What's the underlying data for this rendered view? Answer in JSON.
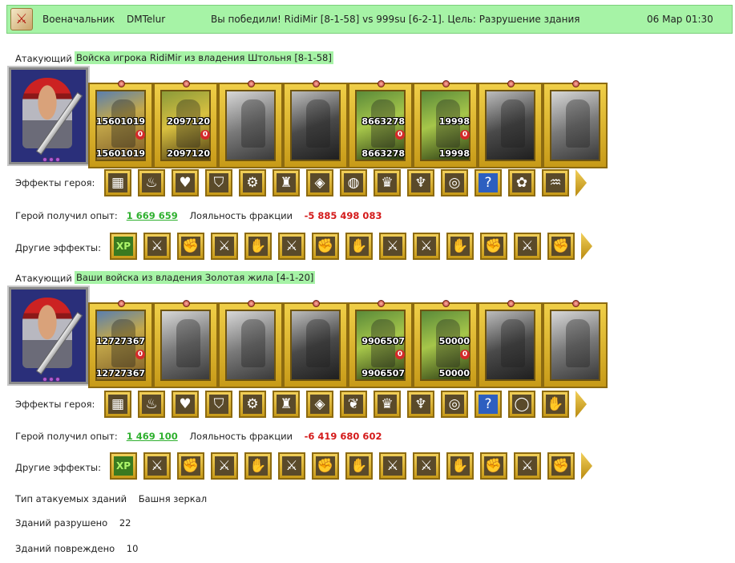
{
  "header": {
    "role": "Военачальник",
    "player": "DMTelur",
    "message": "Вы победили! RidiMir [8-1-58] vs 999su [6-2-1]. Цель: Разрушение здания",
    "datetime": "06 Мар 01:30"
  },
  "attackers": [
    {
      "label": "Атакующий",
      "source": "Войска игрока RidiMir из владения Штольня [8-1-58]",
      "troops": [
        {
          "style": "color",
          "top": "15601019",
          "bottom": "15601019",
          "loss": "0"
        },
        {
          "style": "color2",
          "top": "2097120",
          "bottom": "2097120",
          "loss": "0"
        },
        {
          "style": "gray",
          "top": "",
          "bottom": "",
          "loss": ""
        },
        {
          "style": "dark",
          "top": "",
          "bottom": "",
          "loss": ""
        },
        {
          "style": "color3",
          "top": "8663278",
          "bottom": "8663278",
          "loss": "0"
        },
        {
          "style": "color3",
          "top": "19998",
          "bottom": "19998",
          "loss": "0"
        },
        {
          "style": "dark",
          "top": "",
          "bottom": "",
          "loss": ""
        },
        {
          "style": "gray",
          "top": "",
          "bottom": "",
          "loss": ""
        }
      ],
      "hero_effects_label": "Эффекты героя:",
      "hero_effects": [
        "▦",
        "♨",
        "♥",
        "⛉",
        "⚙",
        "♜",
        "◈",
        "◍",
        "♛",
        "♆",
        "◎",
        "?",
        "✿",
        "♒"
      ],
      "xp_label": "Герой получил опыт:",
      "xp_value": "1 669 659",
      "loyalty_label": "Лояльность фракции",
      "loyalty_value": "-5 885 498 083",
      "other_effects_label": "Другие эффекты:",
      "other_effects": [
        "XP",
        "⚔",
        "✊",
        "⚔",
        "✋",
        "⚔",
        "✊",
        "✋",
        "⚔",
        "⚔",
        "✋",
        "✊",
        "⚔",
        "✊"
      ]
    },
    {
      "label": "Атакующий",
      "source": "Ваши войска из владения Золотая жила [4-1-20]",
      "troops": [
        {
          "style": "color",
          "top": "12727367",
          "bottom": "12727367",
          "loss": "0"
        },
        {
          "style": "gray",
          "top": "",
          "bottom": "",
          "loss": ""
        },
        {
          "style": "gray",
          "top": "",
          "bottom": "",
          "loss": ""
        },
        {
          "style": "dark",
          "top": "",
          "bottom": "",
          "loss": ""
        },
        {
          "style": "color3",
          "top": "9906507",
          "bottom": "9906507",
          "loss": "0"
        },
        {
          "style": "color3",
          "top": "50000",
          "bottom": "50000",
          "loss": "0"
        },
        {
          "style": "dark",
          "top": "",
          "bottom": "",
          "loss": ""
        },
        {
          "style": "gray",
          "top": "",
          "bottom": "",
          "loss": ""
        }
      ],
      "hero_effects_label": "Эффекты героя:",
      "hero_effects": [
        "▦",
        "♨",
        "♥",
        "⛉",
        "⚙",
        "♜",
        "◈",
        "❦",
        "♛",
        "♆",
        "◎",
        "?",
        "◯",
        "✋"
      ],
      "xp_label": "Герой получил опыт:",
      "xp_value": "1 469 100",
      "loyalty_label": "Лояльность фракции",
      "loyalty_value": "-6 419 680 602",
      "other_effects_label": "Другие эффекты:",
      "other_effects": [
        "XP",
        "⚔",
        "✊",
        "⚔",
        "✋",
        "⚔",
        "✊",
        "✋",
        "⚔",
        "⚔",
        "✋",
        "✊",
        "⚔",
        "✊"
      ]
    }
  ],
  "summary": {
    "target_type_label": "Тип атакуемых зданий",
    "target_type_value": "Башня зеркал",
    "destroyed_label": "Зданий разрушено",
    "destroyed_value": "22",
    "damaged_label": "Зданий повреждено",
    "damaged_value": "10"
  }
}
